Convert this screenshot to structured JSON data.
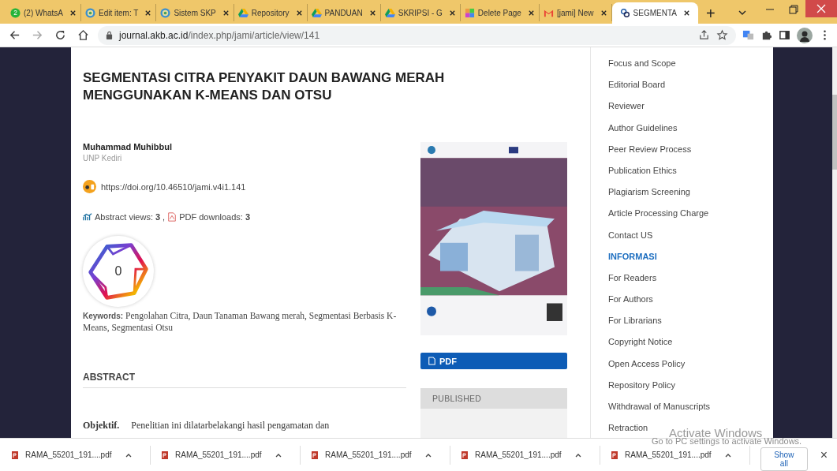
{
  "browser": {
    "tabs": [
      {
        "label": "(2) WhatsA",
        "kind": "whatsapp",
        "badge": "2",
        "selected": false
      },
      {
        "label": "Edit item: T",
        "kind": "emblem",
        "selected": false
      },
      {
        "label": "Sistem SKP",
        "kind": "emblem",
        "selected": false
      },
      {
        "label": "Repository",
        "kind": "drive",
        "selected": false
      },
      {
        "label": "PANDUAN",
        "kind": "drive",
        "selected": false
      },
      {
        "label": "SKRIPSI - G",
        "kind": "drive",
        "selected": false
      },
      {
        "label": "Delete Page",
        "kind": "blocks",
        "selected": false
      },
      {
        "label": "[jami] New",
        "kind": "mail",
        "selected": false
      },
      {
        "label": "SEGMENTA",
        "kind": "logo",
        "selected": true
      }
    ],
    "new_tab": "+",
    "url": {
      "host": "journal.akb.ac.id",
      "path": "/index.php/jami/article/view/141"
    }
  },
  "article": {
    "title": "SEGMENTASI CITRA PENYAKIT DAUN BAWANG MERAH MENGGUNAKAN K-MEANS DAN OTSU",
    "author": "Muhammad Muhibbul",
    "affiliation": "UNP Kediri",
    "doi": "https://doi.org/10.46510/jami.v4i1.141",
    "stats": {
      "views_label": "Abstract views:",
      "views": "3",
      "sep": ",",
      "downloads_label": "PDF downloads:",
      "downloads": "3"
    },
    "badge_count": "0",
    "keywords_label": "Keywords:",
    "keywords": "Pengolahan Citra, Daun Tanaman Bawang merah, Segmentasi Berbasis K-Means, Segmentasi Otsu",
    "abstract_heading": "ABSTRACT",
    "abstract_lead": "Objektif.",
    "abstract_text": "Penelitian ini dilatarbelakangi hasil pengamatan dan"
  },
  "cover": {
    "kind": "picture",
    "pdf_button": "PDF",
    "published_label": "PUBLISHED"
  },
  "sidebar": {
    "items": [
      {
        "kind": "link",
        "label": "Focus and Scope"
      },
      {
        "kind": "link",
        "label": "Editorial Board"
      },
      {
        "kind": "link",
        "label": "Reviewer"
      },
      {
        "kind": "link",
        "label": "Author Guidelines"
      },
      {
        "kind": "link",
        "label": "Peer Review Process"
      },
      {
        "kind": "link",
        "label": "Publication Ethics"
      },
      {
        "kind": "link",
        "label": "Plagiarism Screening"
      },
      {
        "kind": "link",
        "label": "Article Processing Charge"
      },
      {
        "kind": "link",
        "label": "Contact US"
      },
      {
        "kind": "heading",
        "label": "INFORMASI"
      },
      {
        "kind": "link",
        "label": "For Readers"
      },
      {
        "kind": "link",
        "label": "For Authors"
      },
      {
        "kind": "link",
        "label": "For Librarians"
      },
      {
        "kind": "link",
        "label": "Copyright Notice"
      },
      {
        "kind": "link",
        "label": "Open Access Policy"
      },
      {
        "kind": "link",
        "label": "Repository Policy"
      },
      {
        "kind": "link",
        "label": "Withdrawal of Manuscripts"
      },
      {
        "kind": "link",
        "label": "Retraction"
      }
    ]
  },
  "downloads": {
    "files": [
      "RAMA_55201_191....pdf",
      "RAMA_55201_191....pdf",
      "RAMA_55201_191....pdf",
      "RAMA_55201_191....pdf",
      "RAMA_55201_191....pdf"
    ],
    "show_all": "Show all",
    "close": "×"
  },
  "os_notice": {
    "title": "Activate Windows",
    "text": "Go to PC settings to activate Windows."
  }
}
